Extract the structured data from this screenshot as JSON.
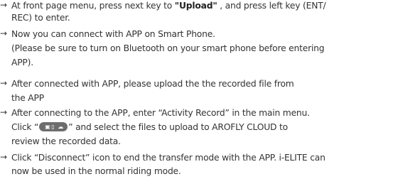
{
  "arrow": "→",
  "items": [
    {
      "line1_pre": "At front page menu, press next key to ",
      "line1_bold": "\"Upload\"",
      "line1_post": " , and press left key (ENT/",
      "line2": "REC) to enter."
    },
    {
      "line1": "Now you can connect with APP on Smart Phone.",
      "line2": "(Please be sure to turn on Bluetooth on your smart phone before entering",
      "line3": "APP)."
    },
    {
      "line1": "After connected with APP, please upload the the recorded file from",
      "line2": "the APP"
    },
    {
      "line1": "After connecting to the APP, enter “Activity Record” in the main menu.",
      "line2_pre": "Click “",
      "line2_post": "” and select the files to upload to AROFLY CLOUD to",
      "line3": "review the recorded data."
    },
    {
      "line1": "Click “Disconnect” icon to end the transfer mode with the APP. i-ELITE can",
      "line2": "now be used in the normal riding mode."
    }
  ],
  "icons": [
    "select-icon",
    "file-icon",
    "cloud-upload-icon"
  ]
}
